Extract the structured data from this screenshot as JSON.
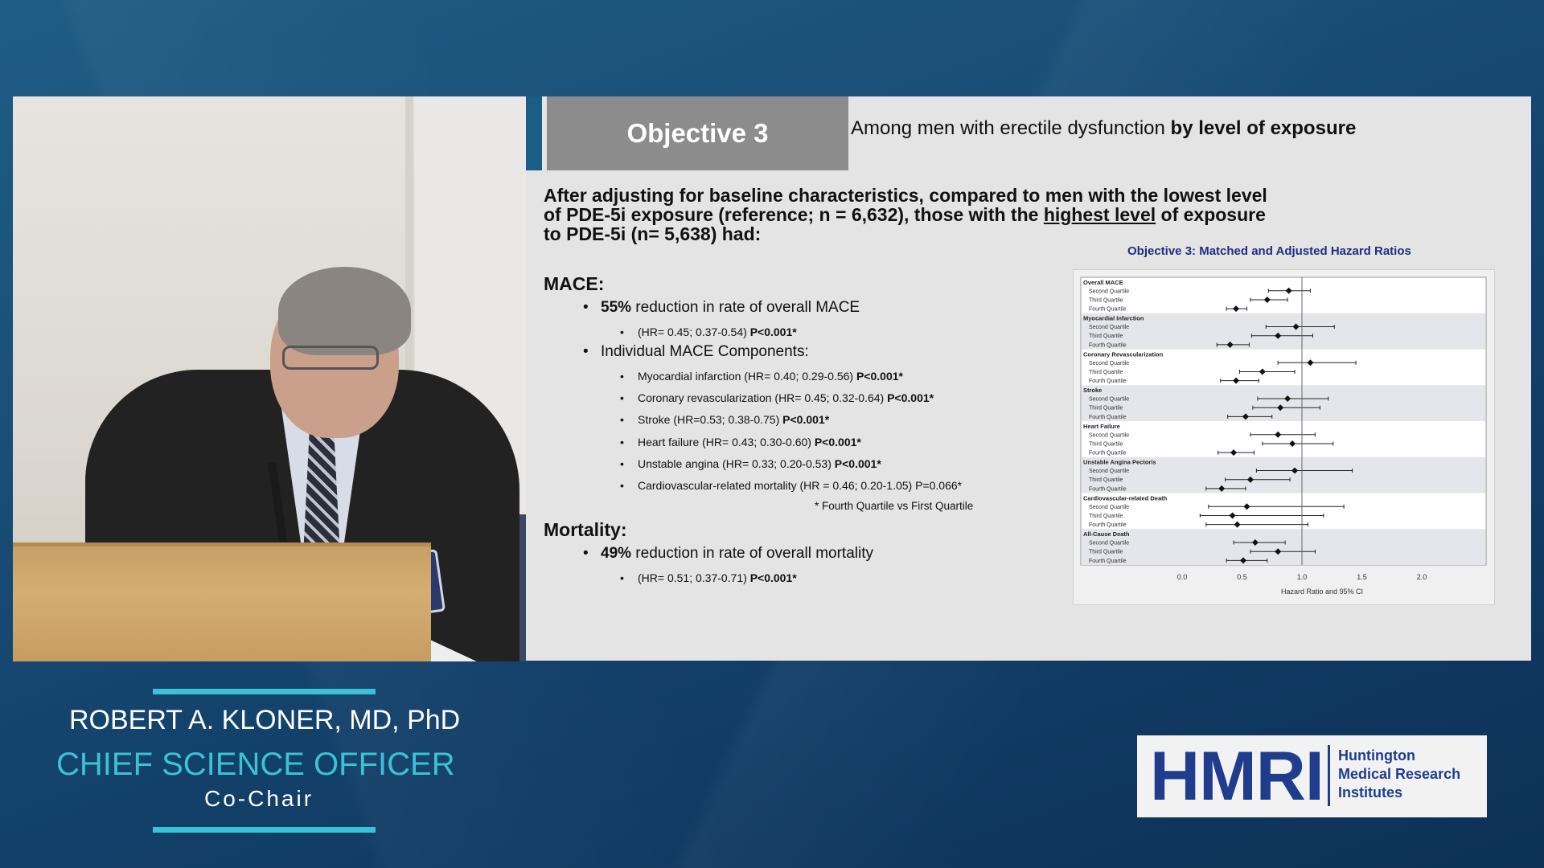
{
  "slide": {
    "objective_label": "Objective 3",
    "objective_subtitle_plain": "Among men with erectile dysfunction ",
    "objective_subtitle_bold": "by level of exposure",
    "intro_line1": "After adjusting for baseline characteristics, compared to men with the lowest level",
    "intro_line2_part1": "of PDE-5i exposure (reference; n = 6,632), those with the ",
    "intro_line2_underlined": "highest level",
    "intro_line2_part2": " of exposure",
    "intro_line3": "to PDE-5i (n= 5,638) had:",
    "mace_heading": "MACE:",
    "mace_pct": "55%",
    "mace_text": " reduction in rate of overall MACE",
    "mace_hr": "(HR= 0.45; 0.37-0.54) ",
    "mace_p": "P<0.001*",
    "components_heading": "Individual MACE Components:",
    "components": [
      {
        "text": "Myocardial infarction (HR= 0.40; 0.29-0.56) ",
        "p": "P<0.001*"
      },
      {
        "text": "Coronary revascularization (HR= 0.45; 0.32-0.64) ",
        "p": "P<0.001*"
      },
      {
        "text": "Stroke (HR=0.53; 0.38-0.75) ",
        "p": "P<0.001*"
      },
      {
        "text": "Heart failure (HR= 0.43; 0.30-0.60) ",
        "p": "P<0.001*"
      },
      {
        "text": "Unstable angina (HR= 0.33; 0.20-0.53) ",
        "p": "P<0.001*"
      },
      {
        "text": "Cardiovascular-related mortality (HR = 0.46; 0.20-1.05) P=0.066*",
        "p": ""
      }
    ],
    "footnote": "* Fourth Quartile vs First Quartile",
    "mortality_heading": "Mortality:",
    "mortality_pct": "49%",
    "mortality_text": " reduction in rate of overall mortality",
    "mortality_hr": "(HR= 0.51; 0.37-0.71) ",
    "mortality_p": "P<0.001*"
  },
  "chart_data": {
    "type": "scatter",
    "title": "Objective 3: Matched and Adjusted Hazard Ratios",
    "xlabel": "Hazard Ratio and 95% CI",
    "ylabel": "",
    "xlim": [
      0.0,
      2.0
    ],
    "xticks": [
      "0.0",
      "0.5",
      "1.0",
      "1.5",
      "2.0"
    ],
    "reference_line": 1.0,
    "groups": [
      {
        "name": "Overall MACE",
        "rows": [
          {
            "label": "Second Quartile",
            "hr": 0.89,
            "lo": 0.72,
            "hi": 1.07
          },
          {
            "label": "Third Quartile",
            "hr": 0.71,
            "lo": 0.57,
            "hi": 0.88
          },
          {
            "label": "Fourth Quartile",
            "hr": 0.45,
            "lo": 0.37,
            "hi": 0.54
          }
        ]
      },
      {
        "name": "Myocardial Infarction",
        "rows": [
          {
            "label": "Second Quartile",
            "hr": 0.95,
            "lo": 0.7,
            "hi": 1.27
          },
          {
            "label": "Third Quartile",
            "hr": 0.8,
            "lo": 0.58,
            "hi": 1.09
          },
          {
            "label": "Fourth Quartile",
            "hr": 0.4,
            "lo": 0.29,
            "hi": 0.56
          }
        ]
      },
      {
        "name": "Coronary Revascularization",
        "rows": [
          {
            "label": "Second Quartile",
            "hr": 1.07,
            "lo": 0.8,
            "hi": 1.45
          },
          {
            "label": "Third Quartile",
            "hr": 0.67,
            "lo": 0.48,
            "hi": 0.94
          },
          {
            "label": "Fourth Quartile",
            "hr": 0.45,
            "lo": 0.32,
            "hi": 0.64
          }
        ]
      },
      {
        "name": "Stroke",
        "rows": [
          {
            "label": "Second Quartile",
            "hr": 0.88,
            "lo": 0.63,
            "hi": 1.22
          },
          {
            "label": "Third Quartile",
            "hr": 0.82,
            "lo": 0.59,
            "hi": 1.15
          },
          {
            "label": "Fourth Quartile",
            "hr": 0.53,
            "lo": 0.38,
            "hi": 0.75
          }
        ]
      },
      {
        "name": "Heart Failure",
        "rows": [
          {
            "label": "Second Quartile",
            "hr": 0.8,
            "lo": 0.57,
            "hi": 1.11
          },
          {
            "label": "Third Quartile",
            "hr": 0.92,
            "lo": 0.67,
            "hi": 1.26
          },
          {
            "label": "Fourth Quartile",
            "hr": 0.43,
            "lo": 0.3,
            "hi": 0.6
          }
        ]
      },
      {
        "name": "Unstable Angina Pectoris",
        "rows": [
          {
            "label": "Second Quartile",
            "hr": 0.94,
            "lo": 0.62,
            "hi": 1.42
          },
          {
            "label": "Third Quartile",
            "hr": 0.57,
            "lo": 0.36,
            "hi": 0.9
          },
          {
            "label": "Fourth Quartile",
            "hr": 0.33,
            "lo": 0.2,
            "hi": 0.53
          }
        ]
      },
      {
        "name": "Cardiovascular-related Death",
        "rows": [
          {
            "label": "Second Quartile",
            "hr": 0.54,
            "lo": 0.22,
            "hi": 1.35
          },
          {
            "label": "Third Quartile",
            "hr": 0.42,
            "lo": 0.15,
            "hi": 1.18
          },
          {
            "label": "Fourth Quartile",
            "hr": 0.46,
            "lo": 0.2,
            "hi": 1.05
          }
        ]
      },
      {
        "name": "All-Cause Death",
        "rows": [
          {
            "label": "Second Quartile",
            "hr": 0.61,
            "lo": 0.43,
            "hi": 0.86
          },
          {
            "label": "Third Quartile",
            "hr": 0.8,
            "lo": 0.57,
            "hi": 1.11
          },
          {
            "label": "Fourth Quartile",
            "hr": 0.51,
            "lo": 0.37,
            "hi": 0.71
          }
        ]
      }
    ]
  },
  "lower_third": {
    "name": "ROBERT A. KLONER, MD, PhD",
    "title": "CHIEF SCIENCE OFFICER",
    "role": "Co-Chair"
  },
  "logo": {
    "mark": "HMRI",
    "line1": "Huntington",
    "line2": "Medical Research",
    "line3": "Institutes"
  },
  "colors": {
    "accent": "#3cc1d6",
    "brand": "#1f3d8c",
    "objective_box": "#8c8c8c"
  }
}
